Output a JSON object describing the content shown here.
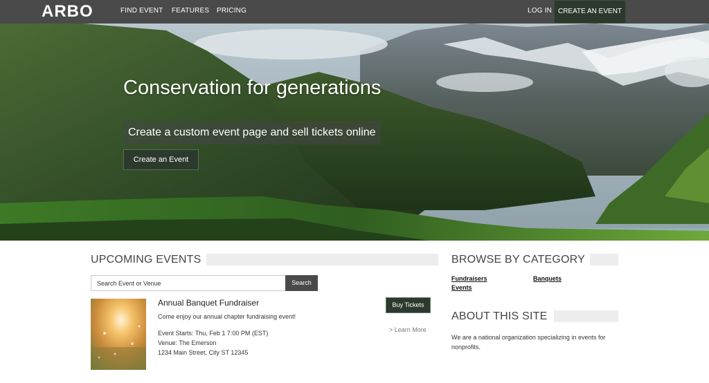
{
  "nav": {
    "logo": "ARBO",
    "items": [
      {
        "label": "FIND EVENT"
      },
      {
        "label": "FEATURES"
      },
      {
        "label": "PRICING"
      }
    ],
    "login": "LOG IN",
    "create_event": "CREATE AN EVENT"
  },
  "hero": {
    "title": "Conservation for generations",
    "subtitle": "Create a custom event page and sell tickets online",
    "button": "Create an Event"
  },
  "upcoming": {
    "heading": "UPCOMING EVENTS",
    "search": {
      "placeholder": "Search Event or Venue",
      "value": "",
      "button": "Search"
    },
    "events": [
      {
        "title": "Annual Banquet Fundraiser",
        "description": "Come enjoy our annual chapter fundraising event!",
        "starts": "Event Starts: Thu, Feb 1 7:00 PM (EST)",
        "venue": "Venue: The Emerson",
        "address": "1234 Main Street, City ST 12345",
        "buy_label": "Buy Tickets",
        "learn_more": "> Learn More"
      }
    ]
  },
  "browse": {
    "heading": "BROWSE BY CATEGORY",
    "categories": [
      "Fundraisers",
      "Banquets",
      "Events"
    ]
  },
  "about": {
    "heading": "ABOUT THIS SITE",
    "text": "We are a national organization specializing in events for nonprofits."
  },
  "colors": {
    "nav_bg": "#4a4a4a",
    "accent_green": "#2c3a2d",
    "section_bar": "#ededed"
  }
}
